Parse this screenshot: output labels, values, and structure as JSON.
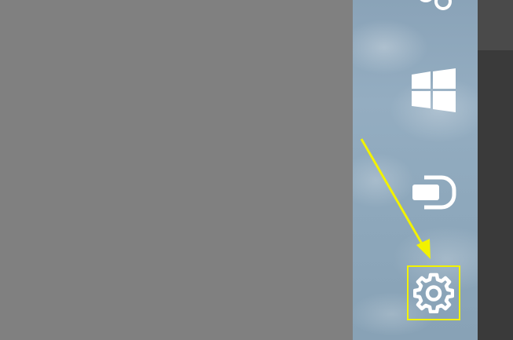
{
  "charms": {
    "share": {
      "icon": "share-icon"
    },
    "start": {
      "icon": "windows-logo-icon"
    },
    "devices": {
      "icon": "devices-icon"
    },
    "settings": {
      "icon": "gear-icon",
      "highlighted": true
    }
  },
  "annotation": {
    "type": "arrow",
    "target": "settings",
    "color": "#f2f200"
  },
  "colors": {
    "desktop": "#808080",
    "charms_bar": "#8ea8bc",
    "icon": "#ffffff",
    "right_edge": "#3a3a3a",
    "highlight": "#f2f200"
  }
}
